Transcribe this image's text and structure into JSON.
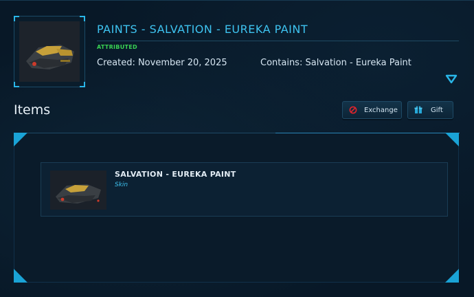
{
  "pledge": {
    "title": "PAINTS - SALVATION - EUREKA PAINT",
    "status": "ATTRIBUTED",
    "created": "Created: November 20, 2025",
    "contains": "Contains: Salvation - Eureka Paint",
    "thumbnail_icon": "ship-paint-thumbnail"
  },
  "items_section": {
    "heading": "Items",
    "actions": [
      {
        "label": "Exchange",
        "icon": "exchange-icon",
        "color": "#e0242c"
      },
      {
        "label": "Gift",
        "icon": "gift-icon",
        "color": "#27a9d8"
      }
    ],
    "items": [
      {
        "name": "SALVATION - EUREKA PAINT",
        "type": "Skin",
        "icon": "ship-paint-thumbnail"
      }
    ]
  },
  "colors": {
    "accent": "#3ec3f0",
    "status_green": "#39d353",
    "background": "#081827"
  }
}
